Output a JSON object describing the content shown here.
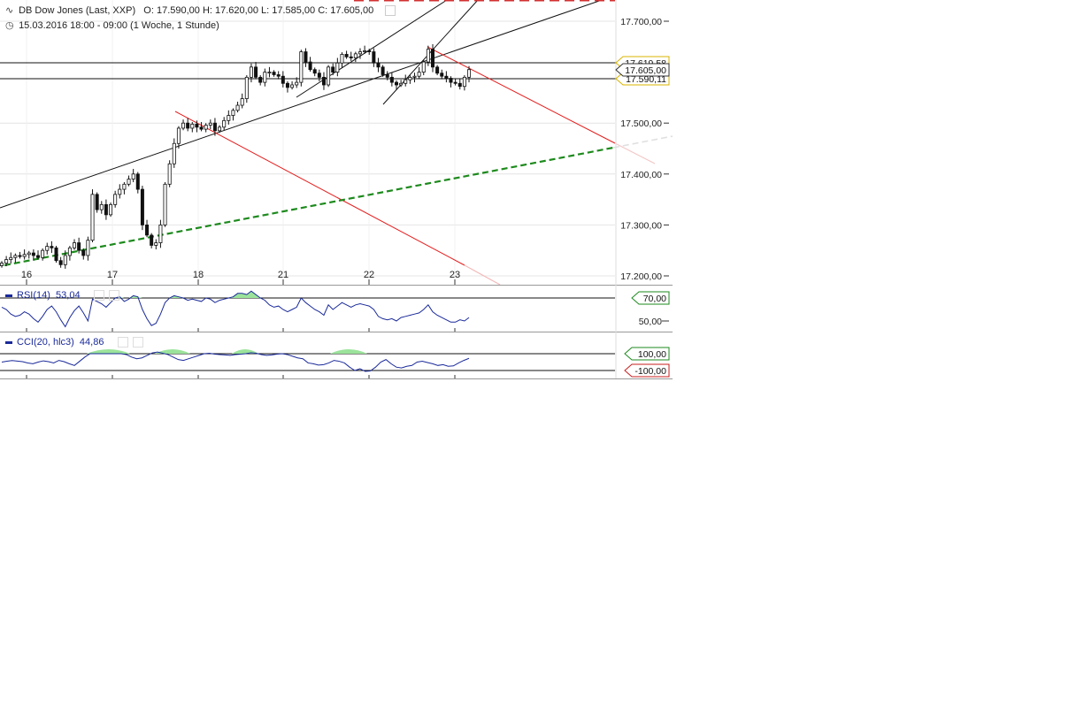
{
  "header": {
    "instrument": "DB Dow Jones (Last, XXP)",
    "ohlc": "O: 17.590,00   H: 17.620,00   L: 17.585,00   C: 17.605,00",
    "period": "15.03.2016 18:00 - 09:00 (1 Woche, 1 Stunde)",
    "chart_icon": "candlestick-chart-icon",
    "clock_icon": "clock-icon"
  },
  "price_axis": {
    "ticks": [
      "17.700,00",
      "17.500,00",
      "17.400,00",
      "17.300,00",
      "17.200,00"
    ],
    "tick_values": [
      17700,
      17500,
      17400,
      17300,
      17200
    ],
    "marker_top": "17.619,58",
    "marker_current": "17.605,00",
    "marker_bottom": "17.590,11"
  },
  "x_axis": {
    "labels": [
      "16",
      "17",
      "18",
      "21",
      "22",
      "23"
    ]
  },
  "rsi": {
    "label": "RSI(14)",
    "value": "53,04",
    "level_high": "70,00",
    "level_mid": "50,00"
  },
  "cci": {
    "label": "CCI(20, hlc3)",
    "value": "44,86",
    "level_high": "100,00",
    "level_low": "-100,00"
  },
  "colors": {
    "candle": "#111111",
    "trend_black": "#111111",
    "trend_red": "#e41d1d",
    "support_green": "#1d8a1d",
    "indicator_line": "#1a2a9a",
    "fill_green": "#9be39b",
    "grid": "#e4e4e4",
    "level_green": "#1d8a1d",
    "level_red": "#c81d1d",
    "marker_gold": "#d8b400"
  },
  "chart_data": {
    "type": "candlestick",
    "x_labels": [
      "16",
      "17",
      "18",
      "21",
      "22",
      "23"
    ],
    "ylim": [
      17180,
      17720
    ],
    "price": {
      "open": [
        17220,
        17225,
        17232,
        17236,
        17240,
        17238,
        17242,
        17245,
        17240,
        17236,
        17250,
        17258,
        17255,
        17230,
        17222,
        17240,
        17255,
        17265,
        17250,
        17240,
        17270,
        17360,
        17330,
        17340,
        17320,
        17340,
        17360,
        17370,
        17380,
        17390,
        17400,
        17370,
        17300,
        17280,
        17260,
        17265,
        17300,
        17380,
        17420,
        17460,
        17490,
        17500,
        17490,
        17498,
        17492,
        17488,
        17496,
        17500,
        17485,
        17492,
        17505,
        17515,
        17525,
        17535,
        17548,
        17590,
        17610,
        17590,
        17580,
        17600,
        17600,
        17595,
        17592,
        17578,
        17570,
        17575,
        17580,
        17640,
        17620,
        17605,
        17598,
        17590,
        17575,
        17610,
        17600,
        17618,
        17635,
        17630,
        17628,
        17636,
        17640,
        17642,
        17640,
        17618,
        17610,
        17595,
        17590,
        17580,
        17575,
        17578,
        17585,
        17590,
        17592,
        17600,
        17620,
        17645,
        17610,
        17598,
        17592,
        17588,
        17580,
        17578,
        17572,
        17590
      ],
      "close": [
        17225,
        17232,
        17236,
        17240,
        17238,
        17242,
        17245,
        17240,
        17236,
        17250,
        17258,
        17255,
        17230,
        17222,
        17240,
        17255,
        17265,
        17250,
        17240,
        17270,
        17360,
        17330,
        17340,
        17320,
        17340,
        17360,
        17370,
        17380,
        17390,
        17400,
        17370,
        17300,
        17280,
        17260,
        17265,
        17300,
        17380,
        17420,
        17460,
        17490,
        17500,
        17490,
        17498,
        17492,
        17488,
        17496,
        17500,
        17485,
        17492,
        17505,
        17515,
        17525,
        17535,
        17548,
        17590,
        17610,
        17590,
        17580,
        17600,
        17600,
        17595,
        17592,
        17578,
        17570,
        17575,
        17580,
        17640,
        17620,
        17605,
        17598,
        17590,
        17575,
        17610,
        17600,
        17618,
        17635,
        17630,
        17628,
        17636,
        17640,
        17642,
        17640,
        17618,
        17610,
        17595,
        17590,
        17580,
        17575,
        17578,
        17585,
        17590,
        17592,
        17600,
        17620,
        17645,
        17610,
        17598,
        17592,
        17588,
        17580,
        17578,
        17572,
        17590,
        17605
      ]
    },
    "rsi": [
      62,
      60,
      56,
      54,
      55,
      58,
      56,
      52,
      49,
      54,
      60,
      63,
      58,
      51,
      45,
      53,
      59,
      63,
      57,
      50,
      69,
      67,
      65,
      62,
      66,
      70,
      71,
      67,
      69,
      72,
      71,
      60,
      52,
      46,
      48,
      56,
      66,
      70,
      72,
      71,
      70,
      68,
      69,
      68,
      67,
      70,
      69,
      66,
      68,
      69,
      70,
      71,
      74,
      74,
      73,
      76,
      73,
      70,
      68,
      64,
      62,
      63,
      60,
      58,
      60,
      62,
      70,
      66,
      63,
      60,
      58,
      55,
      64,
      60,
      63,
      66,
      64,
      62,
      64,
      65,
      64,
      63,
      60,
      54,
      52,
      51,
      52,
      50,
      53,
      54,
      55,
      56,
      57,
      60,
      64,
      58,
      55,
      53,
      51,
      49,
      49,
      51,
      50,
      53
    ],
    "cci": [
      0,
      10,
      18,
      12,
      5,
      -10,
      -20,
      0,
      15,
      5,
      -10,
      20,
      5,
      -20,
      -40,
      10,
      60,
      100,
      100,
      100,
      100,
      100,
      100,
      100,
      90,
      60,
      40,
      50,
      80,
      110,
      120,
      105,
      90,
      60,
      30,
      20,
      40,
      60,
      80,
      100,
      105,
      95,
      90,
      85,
      80,
      90,
      95,
      100,
      110,
      105,
      90,
      80,
      85,
      95,
      100,
      90,
      70,
      50,
      40,
      -10,
      -20,
      -35,
      -30,
      -10,
      20,
      10,
      -10,
      -60,
      -100,
      -80,
      -110,
      -105,
      -60,
      0,
      30,
      -20,
      -60,
      -70,
      -50,
      -40,
      0,
      10,
      -5,
      -20,
      -40,
      -30,
      -50,
      -45,
      -10,
      20,
      44.86
    ],
    "levels": {
      "rsi": [
        70,
        50
      ],
      "cci": [
        100,
        -100
      ]
    }
  }
}
